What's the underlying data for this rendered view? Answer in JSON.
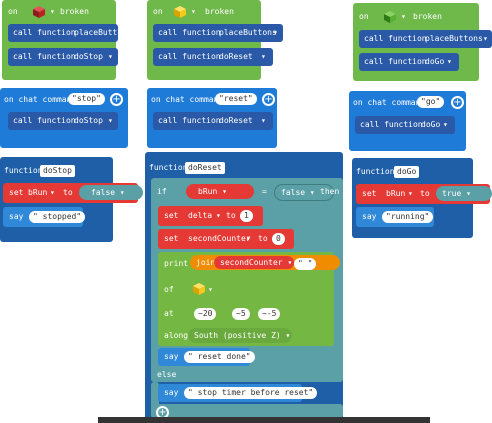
{
  "colors": {
    "event": "#6fb84a",
    "function": "#1e5fa8",
    "chat": "#1f7bd8",
    "variable": "#e53935",
    "say": "#2f88d8",
    "logic": "#5aa0a6",
    "print": "#74b843",
    "pos_red": "#c62828",
    "pos_yellow": "#f6c81a",
    "pos_green": "#55b033"
  },
  "left": {
    "event_on": "on",
    "event_broken": "broken",
    "call": "call function",
    "fn1": "placeButtons",
    "fn2": "doStop",
    "chat_label": "on chat command",
    "chat_value": "\"stop\"",
    "chat_call": "call function",
    "chat_fn": "doStop",
    "func_label": "function",
    "func_name": "doStop",
    "set": "set",
    "var": "bRun",
    "to": "to",
    "bool": "false",
    "say": "say",
    "say_val": "\" stopped\""
  },
  "middle": {
    "event_on": "on",
    "event_broken": "broken",
    "call": "call function",
    "fn1": "placeButtons",
    "fn2": "doReset",
    "chat_label": "on chat command",
    "chat_value": "\"reset\"",
    "chat_call": "call function",
    "chat_fn": "doReset",
    "func_label": "function",
    "func_name": "doReset",
    "if": "if",
    "var": "bRun",
    "eq": "=",
    "bool": "false",
    "then": "then",
    "set": "set",
    "delta": "delta",
    "to": "to",
    "one": "1",
    "counter": "secondCounter",
    "zero": "0",
    "print": "print",
    "join": "join",
    "join_counter": "secondCounter",
    "join_str": "\"  \"",
    "of": "of",
    "at": "at",
    "x": "~20",
    "y": "~5",
    "z": "~-5",
    "along": "along",
    "direction": "South (positive Z)",
    "say": "say",
    "say_val": "\" reset done\"",
    "else": "else",
    "say2": "say",
    "say2_val": "\" stop timer before reset\""
  },
  "right": {
    "event_on": "on",
    "event_broken": "broken",
    "call": "call function",
    "fn1": "placeButtons",
    "fn2": "doGo",
    "chat_label": "on chat command",
    "chat_value": "\"go\"",
    "chat_call": "call function",
    "chat_fn": "doGo",
    "func_label": "function",
    "func_name": "doGo",
    "set": "set",
    "var": "bRun",
    "to": "to",
    "bool": "true",
    "say": "say",
    "say_val": "\"running\""
  }
}
